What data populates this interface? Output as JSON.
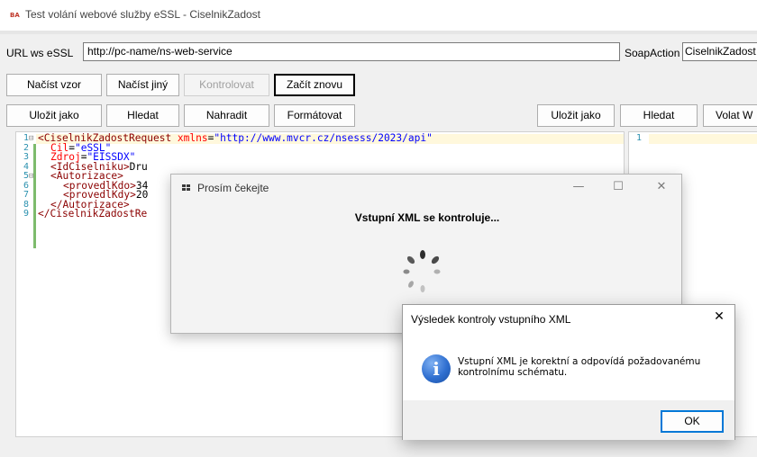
{
  "window": {
    "icon_text": "BA",
    "title": "Test volání webové služby eSSL - CiselnikZadost"
  },
  "url_row": {
    "label": "URL ws eSSL",
    "value": "http://pc-name/ns-web-service",
    "soap_label": "SoapAction",
    "soap_value": "CiselnikZadost"
  },
  "toolbar1": {
    "load_template": "Načíst vzor",
    "load_other": "Načíst jiný",
    "check": "Kontrolovat",
    "restart": "Začít znovu"
  },
  "toolbar2_left": {
    "save_as": "Uložit jako",
    "find": "Hledat",
    "replace": "Nahradit",
    "format": "Formátovat"
  },
  "toolbar2_right": {
    "save_as": "Uložit jako",
    "find": "Hledat",
    "call": "Volat W"
  },
  "editor_left": {
    "line_numbers": [
      "1",
      "2",
      "3",
      "4",
      "5",
      "6",
      "7",
      "8",
      "9"
    ],
    "lines": [
      {
        "tag_open": "<CiselnikZadostRequest ",
        "attr": "xmlns",
        "eq": "=",
        "val": "\"http://www.mvcr.cz/nsesss/2023/api\""
      },
      {
        "attr": "Cil",
        "eq": "=",
        "val": "\"eSSL\""
      },
      {
        "attr": "Zdroj",
        "eq": "=",
        "val": "\"EISSDX\""
      },
      {
        "tag_open": "<IdCiselniku>",
        "text": "Dru"
      },
      {
        "tag_open": "<Autorizace>"
      },
      {
        "tag_open": "<provedlKdo>",
        "text": "34"
      },
      {
        "tag_open": "<provedlKdy>",
        "text": "20"
      },
      {
        "tag_open": "</Autorizace>"
      },
      {
        "tag_open": "</CiselnikZadostRe"
      }
    ]
  },
  "editor_right": {
    "line_numbers": [
      "1"
    ]
  },
  "wait_dialog": {
    "title": "Prosím čekejte",
    "message": "Vstupní XML se kontroluje...",
    "minimize": "—",
    "maximize": "☐",
    "close": "✕"
  },
  "result_dialog": {
    "title": "Výsledek kontroly vstupního XML",
    "close": "✕",
    "icon": "i",
    "message": "Vstupní XML je korektní a odpovídá požadovanému kontrolnímu schématu.",
    "ok": "OK"
  },
  "colors": {
    "xml_tag": "#8b0000",
    "xml_attr": "#ff0000",
    "xml_value": "#0000ff",
    "line_number": "#2b91af",
    "info_icon": "#2f6fd0",
    "ok_border": "#0078d7"
  },
  "icons": {
    "app": "app-logo-icon",
    "wait_dialog": "window-grid-icon",
    "spinner": "loading-spinner-icon",
    "info": "info-icon"
  }
}
